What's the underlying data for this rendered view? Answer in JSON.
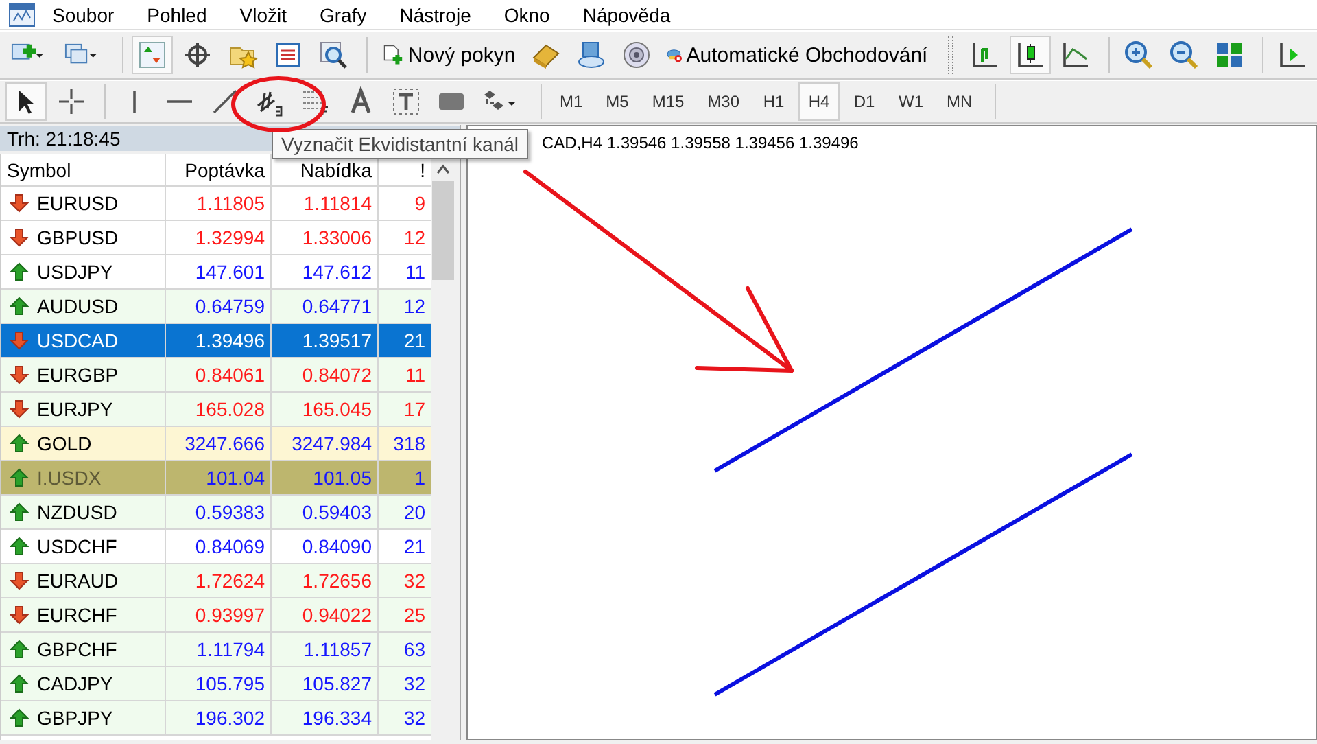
{
  "menu": [
    "Soubor",
    "Pohled",
    "Vložit",
    "Grafy",
    "Nástroje",
    "Okno",
    "Nápověda"
  ],
  "toolbar": [
    {
      "kind": "icon",
      "pressed": false
    },
    {
      "kind": "icon",
      "pressed": false
    },
    {
      "kind": "separator"
    },
    {
      "kind": "icon",
      "pressed": true
    },
    {
      "kind": "icon",
      "pressed": false
    },
    {
      "kind": "icon",
      "pressed": false
    },
    {
      "kind": "icon",
      "pressed": false
    },
    {
      "kind": "icon",
      "pressed": false
    },
    {
      "kind": "separator"
    },
    {
      "kind": "button",
      "label": "Nový pokyn",
      "pressed": false
    },
    {
      "kind": "icon",
      "pressed": false
    },
    {
      "kind": "icon",
      "pressed": false
    },
    {
      "kind": "icon",
      "pressed": false
    },
    {
      "kind": "button",
      "label": "Automatické Obchodování",
      "pressed": false
    },
    {
      "kind": "grip"
    },
    {
      "kind": "icon",
      "pressed": false
    },
    {
      "kind": "icon",
      "pressed": true
    },
    {
      "kind": "icon",
      "pressed": false
    },
    {
      "kind": "separator"
    },
    {
      "kind": "icon",
      "pressed": false
    },
    {
      "kind": "icon",
      "pressed": false
    },
    {
      "kind": "icon",
      "pressed": false
    },
    {
      "kind": "separator"
    },
    {
      "kind": "icon",
      "pressed": false
    }
  ],
  "tools": [
    {
      "kind": "icon",
      "pressed": true
    },
    {
      "kind": "icon",
      "pressed": false
    },
    {
      "kind": "separator"
    },
    {
      "kind": "icon",
      "pressed": false
    },
    {
      "kind": "icon",
      "pressed": false
    },
    {
      "kind": "icon",
      "pressed": false
    },
    {
      "kind": "icon",
      "pressed": false
    },
    {
      "kind": "icon",
      "pressed": false
    },
    {
      "kind": "icon",
      "pressed": false
    },
    {
      "kind": "icon",
      "pressed": false
    },
    {
      "kind": "icon",
      "pressed": false
    },
    {
      "kind": "icon",
      "pressed": false
    },
    {
      "kind": "separator"
    }
  ],
  "timeframes": [
    {
      "label": "M1",
      "selected": false
    },
    {
      "label": "M5",
      "selected": false
    },
    {
      "label": "M15",
      "selected": false
    },
    {
      "label": "M30",
      "selected": false
    },
    {
      "label": "H1",
      "selected": false
    },
    {
      "label": "H4",
      "selected": true
    },
    {
      "label": "D1",
      "selected": false
    },
    {
      "label": "W1",
      "selected": false
    },
    {
      "label": "MN",
      "selected": false
    }
  ],
  "tooltip": "Vyznačit Ekvidistantní kanál",
  "market": {
    "title": "Trh: 21:18:45",
    "columns": [
      "Symbol",
      "Poptávka",
      "Nabídka",
      "!"
    ],
    "rows": [
      {
        "symbol": "EURUSD",
        "bid": "1.11805",
        "ask": "1.11814",
        "spread": "9",
        "rising": false,
        "color": "#ffffff",
        "dimmed": false,
        "selected": false
      },
      {
        "symbol": "GBPUSD",
        "bid": "1.32994",
        "ask": "1.33006",
        "spread": "12",
        "rising": false,
        "color": "#ffffff",
        "dimmed": false,
        "selected": false
      },
      {
        "symbol": "USDJPY",
        "bid": "147.601",
        "ask": "147.612",
        "spread": "11",
        "rising": true,
        "color": "#ffffff",
        "dimmed": false,
        "selected": false
      },
      {
        "symbol": "AUDUSD",
        "bid": "0.64759",
        "ask": "0.64771",
        "spread": "12",
        "rising": true,
        "color": "#f0fbee",
        "dimmed": false,
        "selected": false
      },
      {
        "symbol": "USDCAD",
        "bid": "1.39496",
        "ask": "1.39517",
        "spread": "21",
        "rising": false,
        "dimmed": false,
        "selected": true
      },
      {
        "symbol": "EURGBP",
        "bid": "0.84061",
        "ask": "0.84072",
        "spread": "11",
        "rising": false,
        "color": "#f0fbee",
        "dimmed": false,
        "selected": false
      },
      {
        "symbol": "EURJPY",
        "bid": "165.028",
        "ask": "165.045",
        "spread": "17",
        "rising": false,
        "color": "#f0fbee",
        "dimmed": false,
        "selected": false
      },
      {
        "symbol": "GOLD",
        "bid": "3247.666",
        "ask": "3247.984",
        "spread": "318",
        "rising": true,
        "color": "#fdf6d3",
        "dimmed": false,
        "selected": false
      },
      {
        "symbol": "I.USDX",
        "bid": "101.04",
        "ask": "101.05",
        "spread": "1",
        "rising": true,
        "color": "#bdb66e",
        "dimmed": true,
        "selected": false
      },
      {
        "symbol": "NZDUSD",
        "bid": "0.59383",
        "ask": "0.59403",
        "spread": "20",
        "rising": true,
        "color": "#f0fbee",
        "dimmed": false,
        "selected": false
      },
      {
        "symbol": "USDCHF",
        "bid": "0.84069",
        "ask": "0.84090",
        "spread": "21",
        "rising": true,
        "color": "#ffffff",
        "dimmed": false,
        "selected": false
      },
      {
        "symbol": "EURAUD",
        "bid": "1.72624",
        "ask": "1.72656",
        "spread": "32",
        "rising": false,
        "color": "#f0fbee",
        "dimmed": false,
        "selected": false
      },
      {
        "symbol": "EURCHF",
        "bid": "0.93997",
        "ask": "0.94022",
        "spread": "25",
        "rising": false,
        "color": "#f0fbee",
        "dimmed": false,
        "selected": false
      },
      {
        "symbol": "GBPCHF",
        "bid": "1.11794",
        "ask": "1.11857",
        "spread": "63",
        "rising": true,
        "color": "#f0fbee",
        "dimmed": false,
        "selected": false
      },
      {
        "symbol": "CADJPY",
        "bid": "105.795",
        "ask": "105.827",
        "spread": "32",
        "rising": true,
        "color": "#f0fbee",
        "dimmed": false,
        "selected": false
      },
      {
        "symbol": "GBPJPY",
        "bid": "196.302",
        "ask": "196.334",
        "spread": "32",
        "rising": true,
        "color": "#f0fbee",
        "dimmed": false,
        "selected": false
      }
    ]
  },
  "chart": {
    "header": "CAD,H4 1.39546 1.39558 1.39456 1.39496"
  }
}
